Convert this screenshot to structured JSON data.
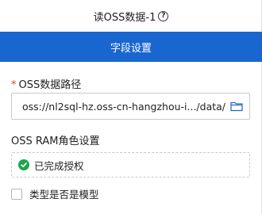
{
  "header": {
    "title": "读OSS数据-1",
    "help_icon": "question-circle-icon",
    "help_glyph": "?"
  },
  "tab": {
    "label": "字段设置",
    "color": "#1a66d1"
  },
  "oss_path": {
    "required_mark": "*",
    "label": "OSS数据路径",
    "value": "oss://nl2sql-hz.oss-cn-hangzhou-i.../data/",
    "browse_icon": "folder-icon"
  },
  "ram_role": {
    "label": "OSS RAM角色设置",
    "status_text": "已完成授权",
    "status_icon": "check-circle-icon",
    "status_color": "#1fa64a"
  },
  "model_option": {
    "label": "类型是否是模型",
    "checked": false
  }
}
